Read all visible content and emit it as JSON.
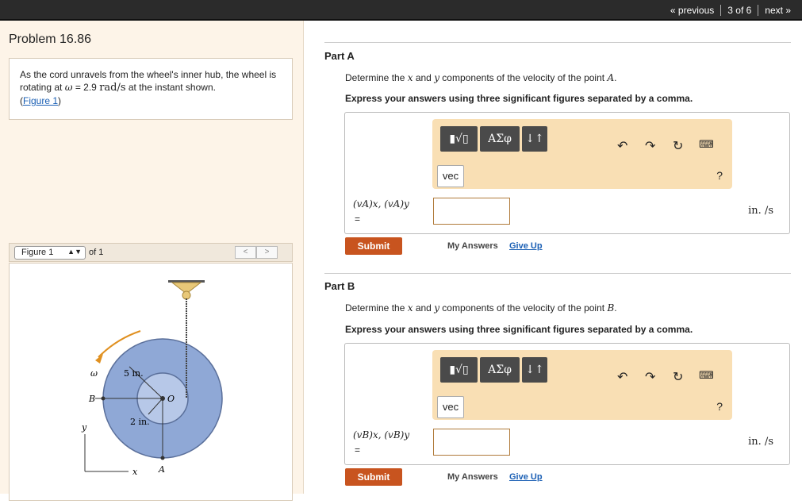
{
  "topnav": {
    "previous": "« previous",
    "page": "3 of 6",
    "next": "next »"
  },
  "problem": {
    "title": "Problem 16.86",
    "text_before": "As the cord unravels from the wheel's inner hub, the wheel is rotating at ",
    "omega_sym": "ω",
    "text_eq": " = 2.9 ",
    "unit": "rad/s",
    "text_after": " at the instant shown.",
    "figure_link": "Figure 1"
  },
  "figure": {
    "selector": "Figure 1",
    "of": "of 1",
    "prev": "<",
    "next": ">",
    "labels": {
      "omega": "ω",
      "r_outer": "5 in.",
      "r_inner": "2 in.",
      "B": "B",
      "O": "O",
      "A": "A",
      "x": "x",
      "y": "y"
    }
  },
  "toolbar": {
    "radical": "▮√▯",
    "greek": "ΑΣφ",
    "arrows": "↓↑",
    "vec": "vec",
    "help": "?"
  },
  "parts": [
    {
      "title": "Part A",
      "q_prefix": "Determine the ",
      "x": "x",
      "q_mid1": " and ",
      "y": "y",
      "q_mid2": " components of the velocity of the point ",
      "point": "A",
      "q_end": ".",
      "instruction": "Express your answers using three significant figures separated by a comma.",
      "label": "(vA)x, (vA)y",
      "eq": "=",
      "unit": "in. /s",
      "submit": "Submit",
      "my_answers": "My Answers",
      "give_up": "Give Up"
    },
    {
      "title": "Part B",
      "q_prefix": "Determine the ",
      "x": "x",
      "q_mid1": " and ",
      "y": "y",
      "q_mid2": " components of the velocity of the point ",
      "point": "B",
      "q_end": ".",
      "instruction": "Express your answers using three significant figures separated by a comma.",
      "label": "(vB)x, (vB)y",
      "eq": "=",
      "unit": "in. /s",
      "submit": "Submit",
      "my_answers": "My Answers",
      "give_up": "Give Up"
    }
  ],
  "colors": {
    "submit": "#c8541f",
    "toolbar": "#f9dfb4",
    "wheel": "#8fa8d6",
    "link": "#1a5fb4"
  }
}
